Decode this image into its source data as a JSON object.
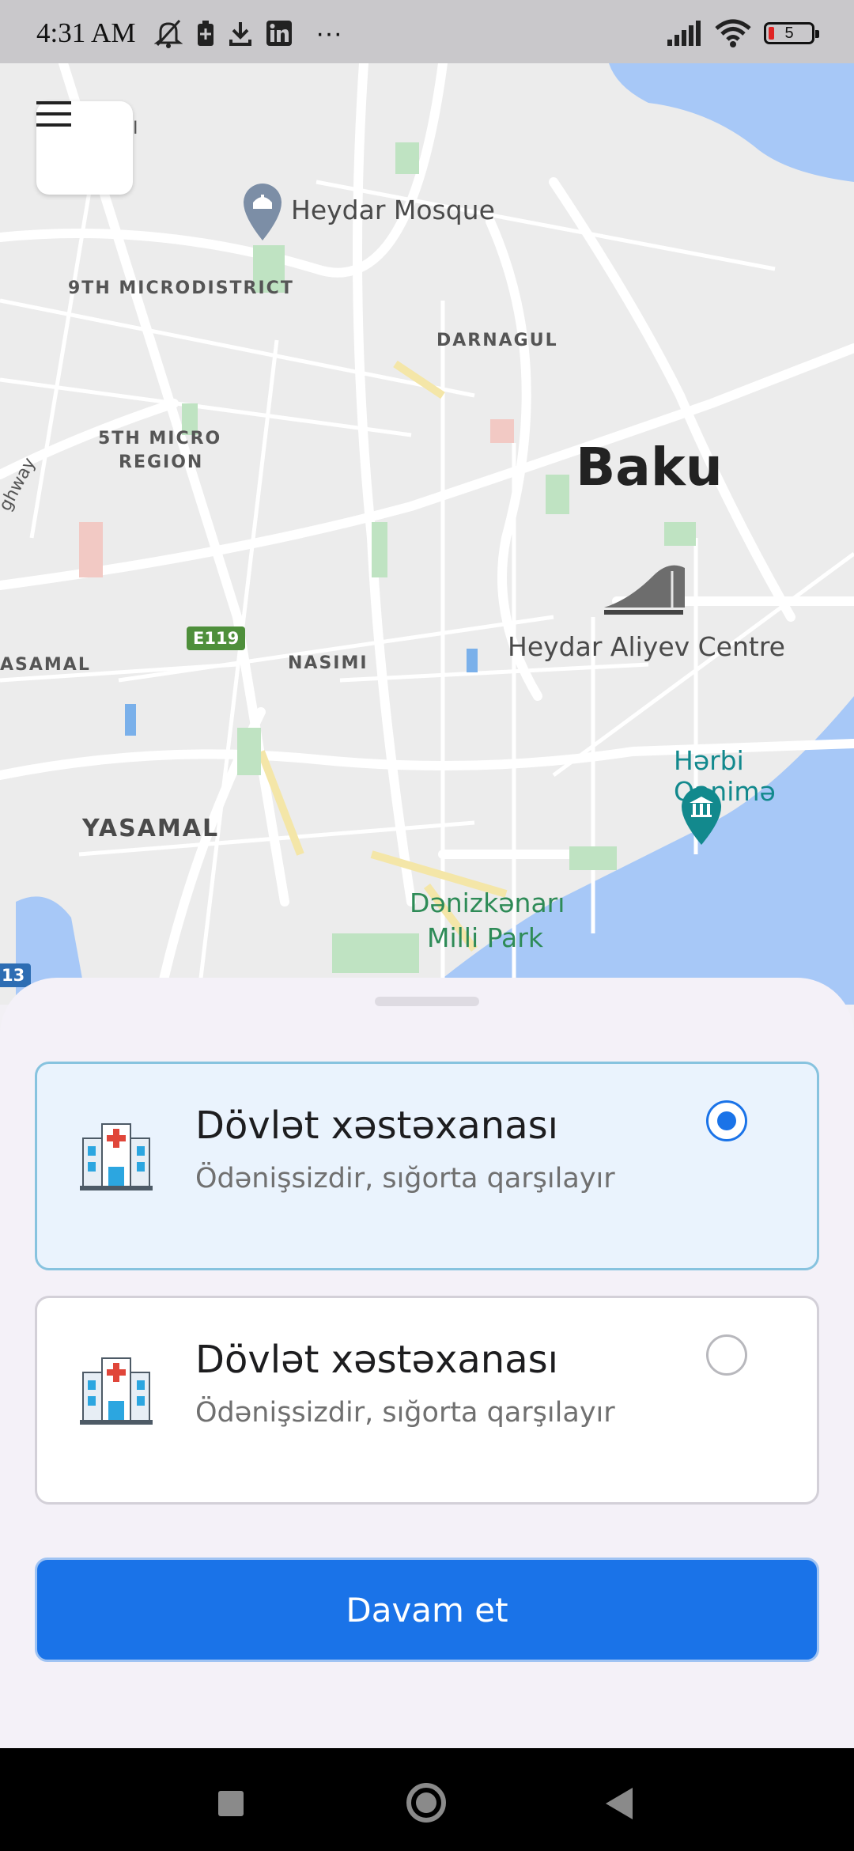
{
  "status_bar": {
    "time": "4:31 AM",
    "more": "···",
    "battery_level": "5",
    "icons_left": [
      "mute-bell-icon",
      "battery-saver-icon",
      "download-icon",
      "linkedin-icon"
    ],
    "icons_right": [
      "signal-icon",
      "wifi-icon",
      "battery-icon"
    ]
  },
  "map": {
    "city": "Baku",
    "districts": {
      "ninth": "9TH MICRODISTRICT",
      "darnagul": "DARNAGUL",
      "fifth_line1": "5TH MICRO",
      "fifth_line2": "REGION",
      "nasimi": "NASIMI",
      "yasamal_edge": "ASAMAL",
      "yasamal": "YASAMAL"
    },
    "pois": {
      "mosque": "Heydar Mosque",
      "centre": "Heydar Aliyev Centre",
      "museum": "Hərbi Qənimə",
      "park_line1": "Dənizkənarı",
      "park_line2": "Milli Park"
    },
    "road_badge": "E119",
    "highway_fragment": "ghway",
    "edge_badge": "13",
    "edge_char": "I",
    "colors": {
      "water": "#a7c8f7",
      "park": "#2e8b57",
      "poi_teal": "#12898d"
    }
  },
  "menu_icon": "hamburger-menu-icon",
  "sheet": {
    "options": [
      {
        "title": "Dövlət xəstəxanası",
        "subtitle": "Ödənişsizdir, sığorta qarşılayır",
        "selected": true,
        "icon": "hospital-icon"
      },
      {
        "title": "Dövlət xəstəxanası",
        "subtitle": "Ödənişsizdir, sığorta qarşılayır",
        "selected": false,
        "icon": "hospital-icon"
      }
    ],
    "continue_label": "Davam et",
    "accent": "#1a73e8"
  },
  "nav": {
    "icons": [
      "recents-icon",
      "home-icon",
      "back-icon"
    ]
  }
}
